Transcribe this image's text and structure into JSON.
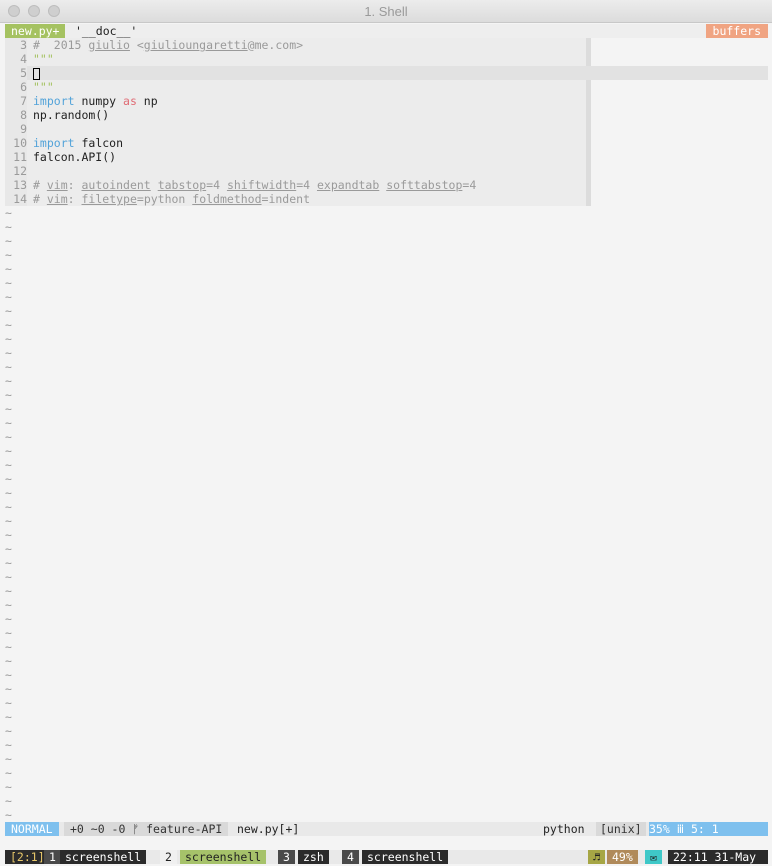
{
  "window": {
    "title": "1. Shell"
  },
  "tabline": {
    "active_tab": "new.py+",
    "tag": "'__doc__'",
    "buffers_label": "buffers"
  },
  "editor": {
    "lines": [
      {
        "num": "3",
        "html": "<span class='cm'>#  2015 </span><span class='cmu'>giulio</span><span class='cm'> &lt;</span><span class='cmu'>giulioungaretti</span><span class='cm'>@me.com&gt;</span>"
      },
      {
        "num": "4",
        "html": "<span class='st'>\"\"\"</span>"
      },
      {
        "num": "5",
        "html": "<span class='cursor'></span>",
        "current": true
      },
      {
        "num": "6",
        "html": "<span class='st'>\"\"\"</span>"
      },
      {
        "num": "7",
        "html": "<span class='kw'>import</span> numpy <span class='kw2'>as</span> np"
      },
      {
        "num": "8",
        "html": "np.random()"
      },
      {
        "num": "9",
        "html": ""
      },
      {
        "num": "10",
        "html": "<span class='kw'>import</span> falcon"
      },
      {
        "num": "11",
        "html": "falcon.API()"
      },
      {
        "num": "12",
        "html": ""
      },
      {
        "num": "13",
        "html": "<span class='cm'># </span><span class='cmu'>vim</span><span class='cm'>: </span><span class='cmu'>autoindent</span><span class='cm'> </span><span class='cmu'>tabstop</span><span class='cm'>=4 </span><span class='cmu'>shiftwidth</span><span class='cm'>=4 </span><span class='cmu'>expandtab</span><span class='cm'> </span><span class='cmu'>softtabstop</span><span class='cm'>=4</span>"
      },
      {
        "num": "14",
        "html": "<span class='cm'># </span><span class='cmu'>vim</span><span class='cm'>: </span><span class='cmu'>filetype</span><span class='cm'>=python </span><span class='cmu'>foldmethod</span><span class='cm'>=indent</span>"
      }
    ],
    "tilde": "~"
  },
  "statusline": {
    "mode": "NORMAL",
    "diff": "+0 ~0 -0 ᚠ feature-API",
    "filename": "new.py[+]",
    "filetype": "python",
    "fileformat": "[unix]",
    "position": " 35% ⅲ  5:  1"
  },
  "tmux": {
    "session": "[2:1]",
    "windows": [
      {
        "num": "1",
        "name": "screenshell"
      },
      {
        "num": "2",
        "name": "screenshell"
      },
      {
        "num": "3",
        "name": "zsh"
      },
      {
        "num": "4",
        "name": "screenshell"
      }
    ],
    "music": "♬",
    "battery": "49%",
    "mail": "✉",
    "time": "22:11 31-May"
  },
  "colors": {
    "accent_green": "#a5c261",
    "accent_blue": "#7ec0ee",
    "buffers_orange": "#f0a482"
  }
}
